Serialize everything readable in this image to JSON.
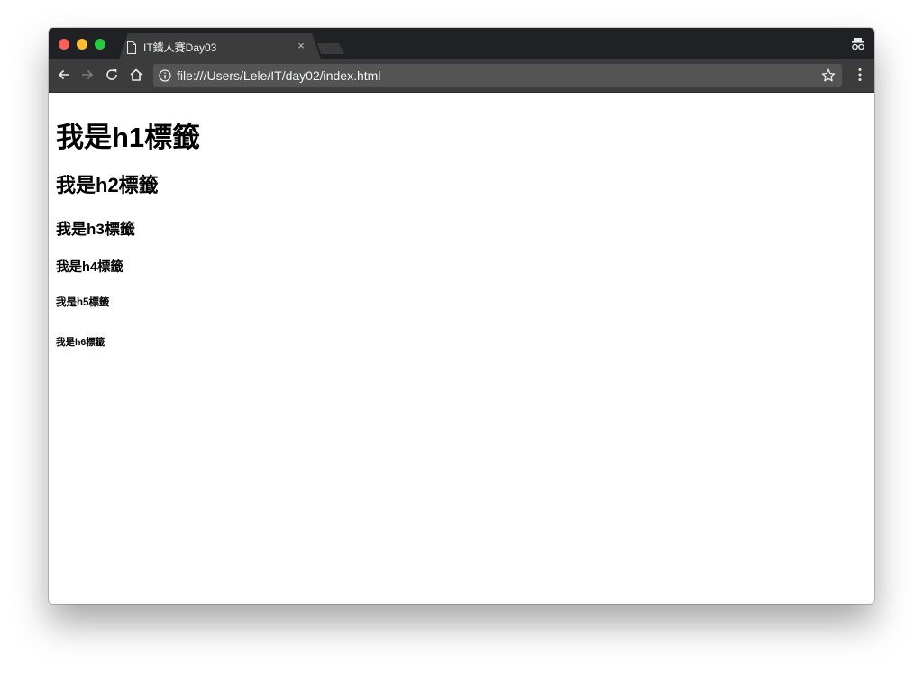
{
  "browser": {
    "tab": {
      "title": "IT鐵人賽Day03",
      "close_label": "×"
    },
    "toolbar": {
      "url": "file:///Users/Lele/IT/day02/index.html"
    },
    "icons": {
      "back": "back-arrow-icon",
      "forward": "forward-arrow-icon",
      "reload": "reload-icon",
      "home": "home-icon",
      "info": "info-icon",
      "bookmark": "star-icon",
      "menu": "kebab-menu-icon",
      "incognito": "incognito-icon",
      "page": "page-icon"
    },
    "colors": {
      "tabstrip": "#202124",
      "toolbar": "#3c3c3c",
      "omnibox": "#545454",
      "close": "#fe5f57",
      "minimize": "#febc2e",
      "maximize": "#28c840"
    }
  },
  "content": {
    "h1": "我是h1標籤",
    "h2": "我是h2標籤",
    "h3": "我是h3標籤",
    "h4": "我是h4標籤",
    "h5": "我是h5標籤",
    "h6": "我是h6標籤"
  }
}
